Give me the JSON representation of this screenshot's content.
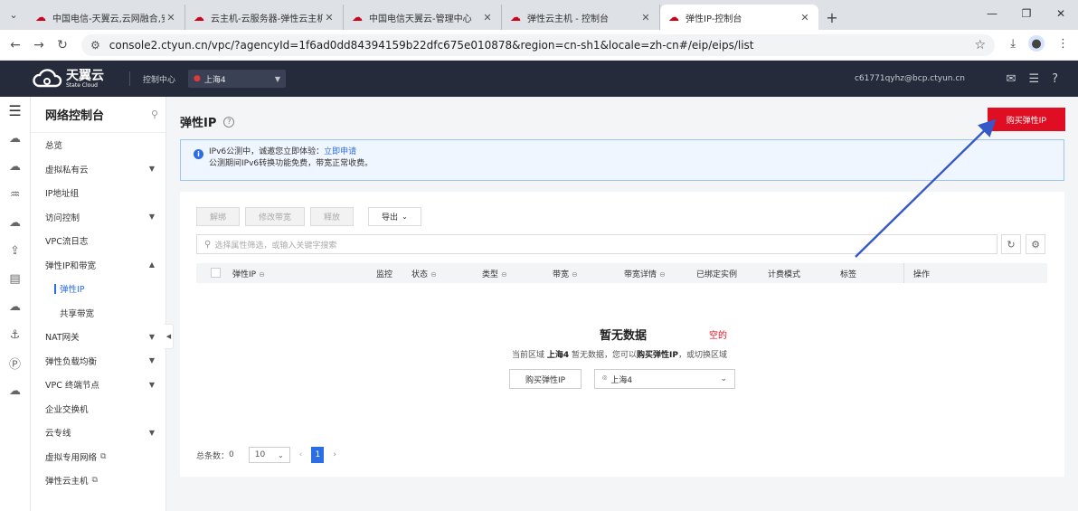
{
  "browser": {
    "tabs": [
      {
        "title": "中国电信-天翼云,云网融合,安全"
      },
      {
        "title": "云主机-云服务器-弹性云主机-"
      },
      {
        "title": "中国电信天翼云-管理中心"
      },
      {
        "title": "弹性云主机 - 控制台"
      },
      {
        "title": "弹性IP-控制台",
        "active": true
      }
    ],
    "url": "console2.ctyun.cn/vpc/?agencyId=1f6ad0dd84394159b22dfc675e010878&region=cn-sh1&locale=zh-cn#/eip/eips/list"
  },
  "topnav": {
    "brand": "天翼云",
    "brand_sub": "State Cloud",
    "console_label": "控制中心",
    "region": "上海4",
    "user_email": "c61771qyhz@bcp.ctyun.cn"
  },
  "sidebar": {
    "title": "网络控制台",
    "items": [
      {
        "label": "总览"
      },
      {
        "label": "虚拟私有云",
        "arrow": "down"
      },
      {
        "label": "IP地址组"
      },
      {
        "label": "访问控制",
        "arrow": "down"
      },
      {
        "label": "VPC流日志"
      },
      {
        "label": "弹性IP和带宽",
        "arrow": "up"
      },
      {
        "label": "弹性IP",
        "sub": true,
        "active": true
      },
      {
        "label": "共享带宽",
        "sub": true
      },
      {
        "label": "NAT网关",
        "arrow": "down"
      },
      {
        "label": "弹性负载均衡",
        "arrow": "down"
      },
      {
        "label": "VPC 终端节点",
        "arrow": "down"
      },
      {
        "label": "企业交换机"
      },
      {
        "label": "云专线",
        "arrow": "down"
      },
      {
        "label": "虚拟专用网络",
        "external": true
      },
      {
        "label": "弹性云主机",
        "external": true
      }
    ]
  },
  "page": {
    "title": "弹性IP",
    "buy_button": "购买弹性IP",
    "notice_line1": "IPv6公测中，诚邀您立即体验：",
    "notice_link": "立即申请",
    "notice_line2": "公测期间IPv6转换功能免费，带宽正常收费。",
    "toolbar": {
      "unbind": "解绑",
      "modify_bw": "修改带宽",
      "release": "释放",
      "export": "导出"
    },
    "search_placeholder": "选择属性筛选，或输入关键字搜索",
    "columns": [
      "弹性IP",
      "监控",
      "状态",
      "类型",
      "带宽",
      "带宽详情",
      "已绑定实例",
      "计费模式",
      "标签",
      "操作"
    ],
    "empty": {
      "title": "暂无数据",
      "annotation": "空的",
      "desc_prefix": "当前区域",
      "desc_region": "上海4",
      "desc_mid": "暂无数据，您可以",
      "desc_action": "购买弹性IP",
      "desc_suffix": "，或切换区域",
      "buy_button": "购买弹性IP",
      "region": "上海4"
    },
    "pager": {
      "total_label": "总条数：",
      "total": "0",
      "page_size": "10",
      "current_page": "1"
    }
  },
  "colors": {
    "accent": "#e00e22",
    "link": "#2b6de5",
    "nav_bg": "#252b3a",
    "arrow": "#3558c9"
  }
}
